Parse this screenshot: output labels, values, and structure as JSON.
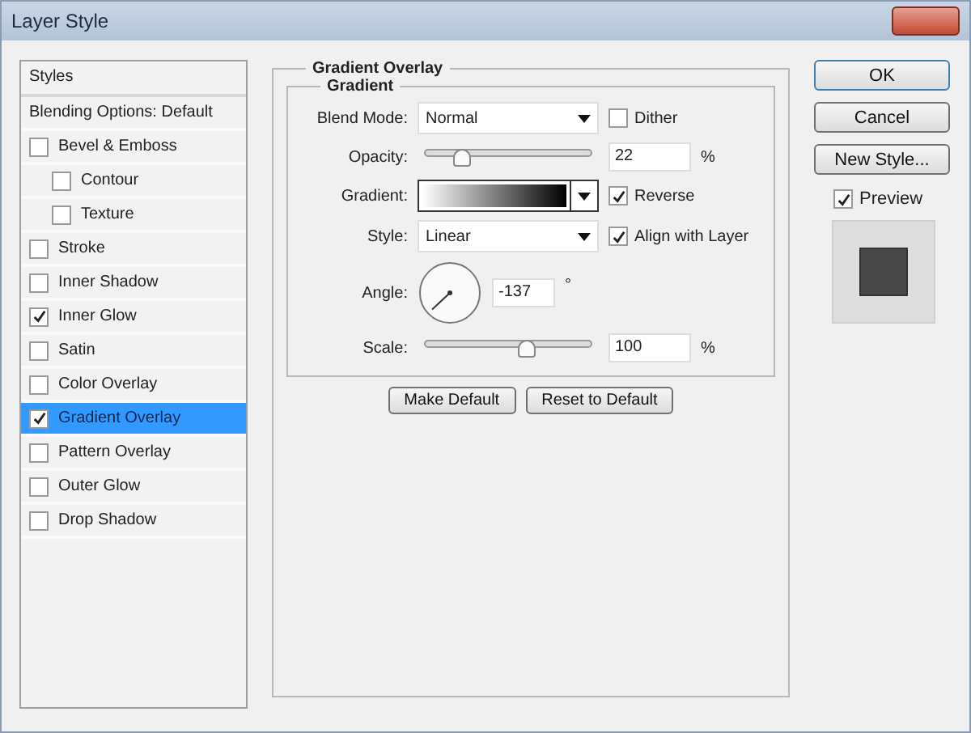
{
  "window": {
    "title": "Layer Style"
  },
  "styles_list": {
    "header": "Styles",
    "items": [
      {
        "kind": "heading",
        "label": "Blending Options: Default",
        "selected": false
      },
      {
        "kind": "check",
        "label": "Bevel & Emboss",
        "checked": false,
        "selected": false,
        "children": [
          {
            "kind": "check",
            "label": "Contour",
            "checked": false,
            "selected": false
          },
          {
            "kind": "check",
            "label": "Texture",
            "checked": false,
            "selected": false
          }
        ]
      },
      {
        "kind": "check",
        "label": "Stroke",
        "checked": false,
        "selected": false
      },
      {
        "kind": "check",
        "label": "Inner Shadow",
        "checked": false,
        "selected": false
      },
      {
        "kind": "check",
        "label": "Inner Glow",
        "checked": true,
        "selected": false
      },
      {
        "kind": "check",
        "label": "Satin",
        "checked": false,
        "selected": false
      },
      {
        "kind": "check",
        "label": "Color Overlay",
        "checked": false,
        "selected": false
      },
      {
        "kind": "check",
        "label": "Gradient Overlay",
        "checked": true,
        "selected": true
      },
      {
        "kind": "check",
        "label": "Pattern Overlay",
        "checked": false,
        "selected": false
      },
      {
        "kind": "check",
        "label": "Outer Glow",
        "checked": false,
        "selected": false
      },
      {
        "kind": "check",
        "label": "Drop Shadow",
        "checked": false,
        "selected": false
      }
    ]
  },
  "settings": {
    "section_title": "Gradient Overlay",
    "group_title": "Gradient",
    "blend_mode": {
      "label": "Blend Mode:",
      "value": "Normal"
    },
    "dither": {
      "label": "Dither",
      "checked": false
    },
    "opacity": {
      "label": "Opacity:",
      "level": 0.22,
      "value": "22",
      "unit": "%"
    },
    "gradient": {
      "label": "Gradient:"
    },
    "reverse": {
      "label": "Reverse",
      "checked": true
    },
    "style": {
      "label": "Style:",
      "value": "Linear"
    },
    "align_with_layer": {
      "label": "Align with Layer",
      "checked": true
    },
    "angle": {
      "label": "Angle:",
      "value": "-137",
      "unit": "°"
    },
    "scale": {
      "label": "Scale:",
      "level": 0.61,
      "value": "100",
      "unit": "%"
    },
    "buttons": [
      "Make Default",
      "Reset to Default"
    ]
  },
  "actions": {
    "buttons": [
      "OK",
      "Cancel",
      "New Style..."
    ],
    "preview": {
      "label": "Preview",
      "checked": true
    }
  }
}
